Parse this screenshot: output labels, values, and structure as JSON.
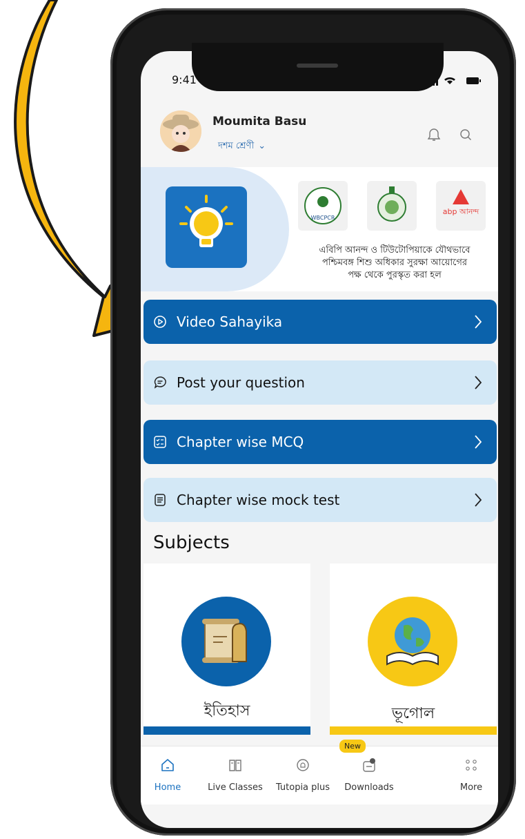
{
  "status_bar": {
    "time": "9:41"
  },
  "profile": {
    "name": "Moumita Basu",
    "grade": "দশম শ্রেণী"
  },
  "banner": {
    "lines": [
      "এবিপি আনন্দ ও টিউটোপিয়াকে যৌথভাবে",
      "পশ্চিমবঙ্গ শিশু অধিকার সুরক্ষা আয়োগের",
      "পক্ষ থেকে পুরস্কৃত করা হল"
    ],
    "logo_wbcpcr": "WBCPCR",
    "logo_abp": "abp আনন্দ"
  },
  "menu": [
    {
      "label": "Video Sahayika",
      "icon": "play-circle-icon",
      "style": "dark"
    },
    {
      "label": "Post your question",
      "icon": "chat-bubble-icon",
      "style": "light"
    },
    {
      "label": "Chapter wise MCQ",
      "icon": "checklist-icon",
      "style": "dark"
    },
    {
      "label": "Chapter wise mock test",
      "icon": "document-icon",
      "style": "light"
    }
  ],
  "subjects": {
    "title": "Subjects",
    "items": [
      {
        "label": "ইতিহাস",
        "icon": "history-scroll-icon",
        "circle_color": "#0b62ab",
        "bar_color": "#0b62ab"
      },
      {
        "label": "ভূগোল",
        "icon": "globe-book-icon",
        "circle_color": "#f7c815",
        "bar_color": "#f7c815"
      }
    ]
  },
  "bottom_nav": {
    "items": [
      {
        "label": "Home",
        "icon": "home-icon",
        "active": true
      },
      {
        "label": "Live Classes",
        "icon": "book-icon",
        "active": false
      },
      {
        "label": "Tutopia plus",
        "icon": "tutopia-plus-icon",
        "active": false
      },
      {
        "label": "Downloads",
        "icon": "downloads-icon",
        "active": false
      },
      {
        "label": "More",
        "icon": "grid-dots-icon",
        "active": false
      }
    ],
    "new_badge": "New"
  },
  "colors": {
    "primary_blue": "#0b62ab",
    "light_blue": "#d3e8f6",
    "yellow": "#f7c815",
    "arrow_yellow": "#f5b50f"
  }
}
